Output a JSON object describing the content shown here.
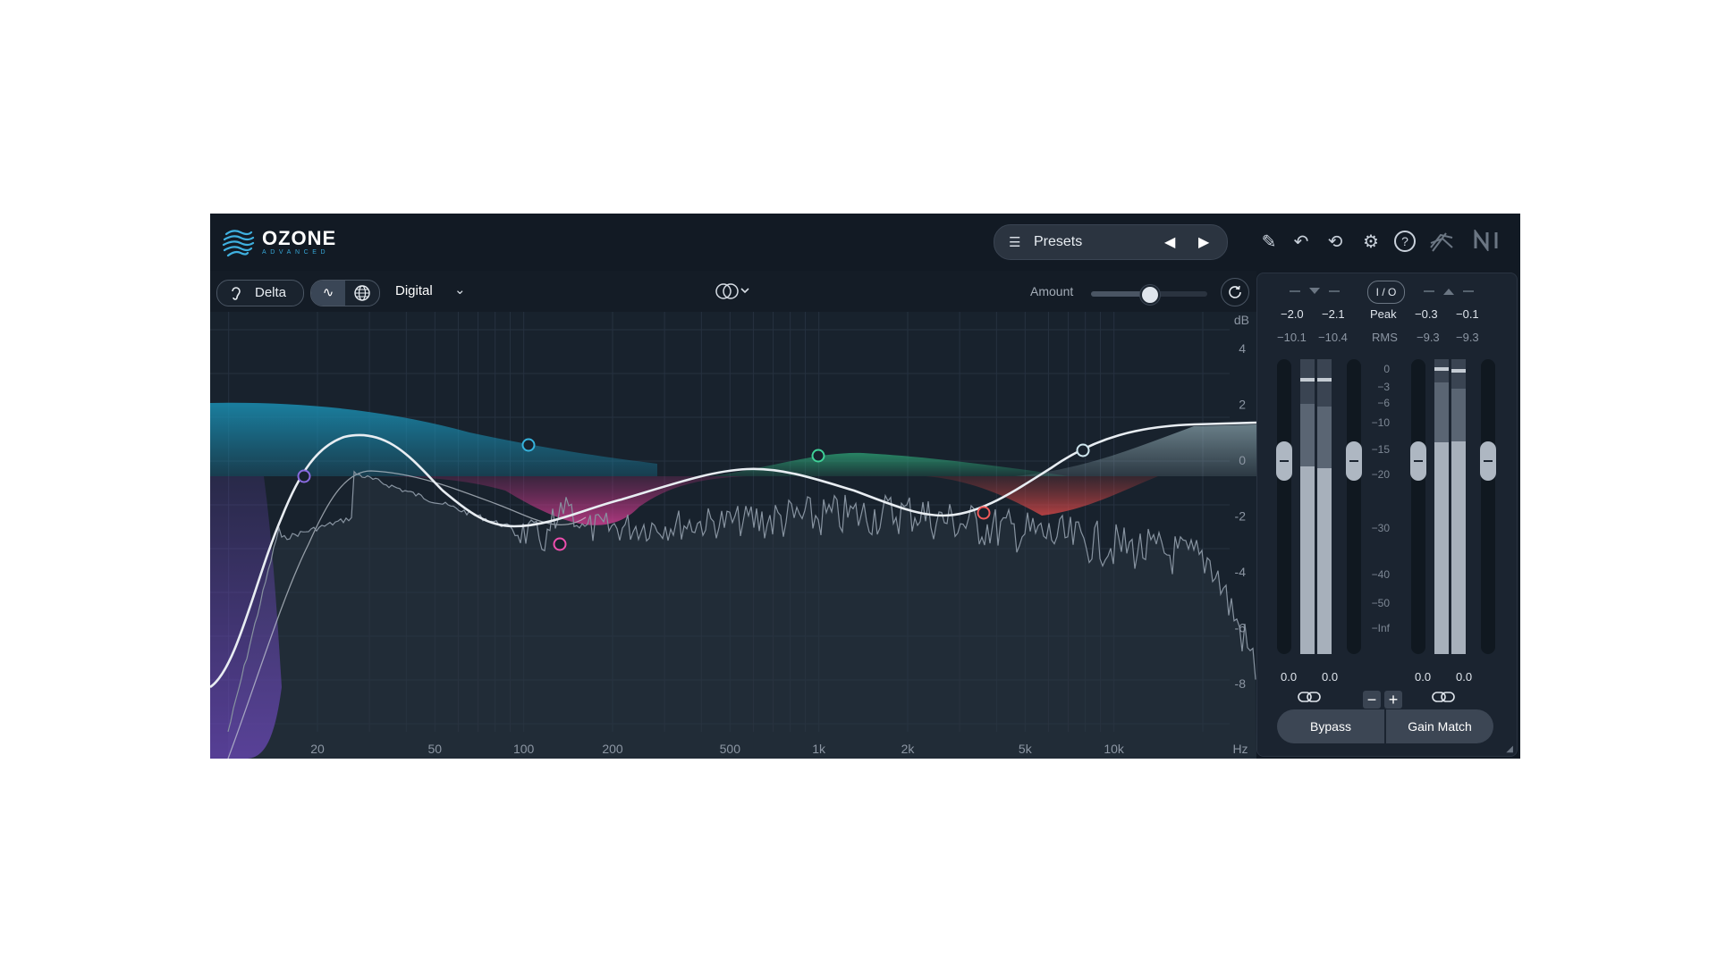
{
  "app": {
    "logo_title": "OZONE",
    "logo_subtitle": "ADVANCED"
  },
  "header": {
    "presets_label": "Presets",
    "icons": [
      "pencil-icon",
      "undo-icon",
      "history-icon",
      "gear-icon",
      "help-icon",
      "ozone-mark-icon",
      "ni-logo-icon"
    ]
  },
  "toolbar": {
    "delta_label": "Delta",
    "mode": "Digital",
    "amount_label": "Amount",
    "amount_value": 0.5
  },
  "eq": {
    "db_unit": "dB",
    "db_ticks": [
      "4",
      "2",
      "0",
      "-2",
      "-4",
      "-6",
      "-8"
    ],
    "freq_ticks": [
      "20",
      "50",
      "100",
      "200",
      "500",
      "1k",
      "2k",
      "5k",
      "10k"
    ],
    "freq_unit": "Hz",
    "colors": {
      "band_low": "#7a5ac9",
      "band_shelf": "#1e9bc4",
      "band_mid_low": "#e0409a",
      "band_mid": "#2fae7c",
      "band_mid_high": "#e54a4a",
      "band_high_shelf": "#b8d8e0",
      "curve": "#e8edf2"
    }
  },
  "meters": {
    "io_label": "I / O",
    "in_peak": [
      "−2.0",
      "−2.1"
    ],
    "in_rms": [
      "−10.1",
      "−10.4"
    ],
    "out_peak": [
      "−0.3",
      "−0.1"
    ],
    "out_rms": [
      "−9.3",
      "−9.3"
    ],
    "peak_label": "Peak",
    "rms_label": "RMS",
    "scale": [
      "0",
      "−3",
      "−6",
      "−10",
      "−15",
      "−20",
      "−30",
      "−40",
      "−50",
      "−Inf"
    ],
    "in_gain": [
      "0.0",
      "0.0"
    ],
    "out_gain": [
      "0.0",
      "0.0"
    ],
    "in_levels": [
      0.85,
      0.84
    ],
    "out_levels": [
      0.92,
      0.9
    ],
    "bypass_label": "Bypass",
    "gain_match_label": "Gain Match"
  }
}
